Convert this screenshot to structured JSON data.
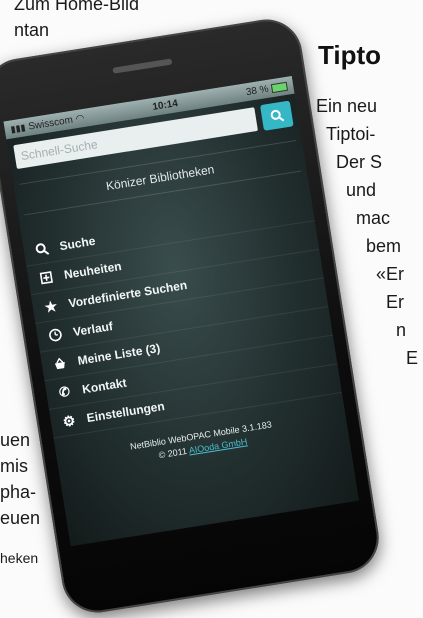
{
  "background": {
    "top_left": [
      "Zum Home-Bild",
      "ntan"
    ],
    "right_title": "Tipto",
    "right_lines": [
      "Ein neu",
      "Tiptoi-",
      "Der S",
      "und",
      "mac",
      "bem",
      "«Er",
      "Er",
      "n",
      "E"
    ],
    "bottom_left": [
      "uen",
      "mis",
      "pha-",
      "euen",
      "heken"
    ]
  },
  "phone": {
    "status": {
      "carrier": "Swisscom",
      "time": "10:14",
      "battery": "38 %"
    },
    "search": {
      "placeholder": "Schnell-Suche"
    },
    "library_name": "Könizer Bibliotheken",
    "menu": [
      {
        "icon": "search-icon",
        "label": "Suche"
      },
      {
        "icon": "new-items-icon",
        "label": "Neuheiten"
      },
      {
        "icon": "star-icon",
        "label": "Vordefinierte Suchen"
      },
      {
        "icon": "clock-icon",
        "label": "Verlauf"
      },
      {
        "icon": "basket-icon",
        "label": "Meine Liste (3)"
      },
      {
        "icon": "phone-icon",
        "label": "Kontakt"
      },
      {
        "icon": "settings-icon",
        "label": "Einstellungen"
      }
    ],
    "footer": {
      "line1": "NetBiblio WebOPAC Mobile 3.1.183",
      "line2_prefix": "© 2011",
      "line2_link": "AIOoda GmbH"
    }
  },
  "colors": {
    "accent": "#36b7c6",
    "screen": "#2b3a3a"
  }
}
